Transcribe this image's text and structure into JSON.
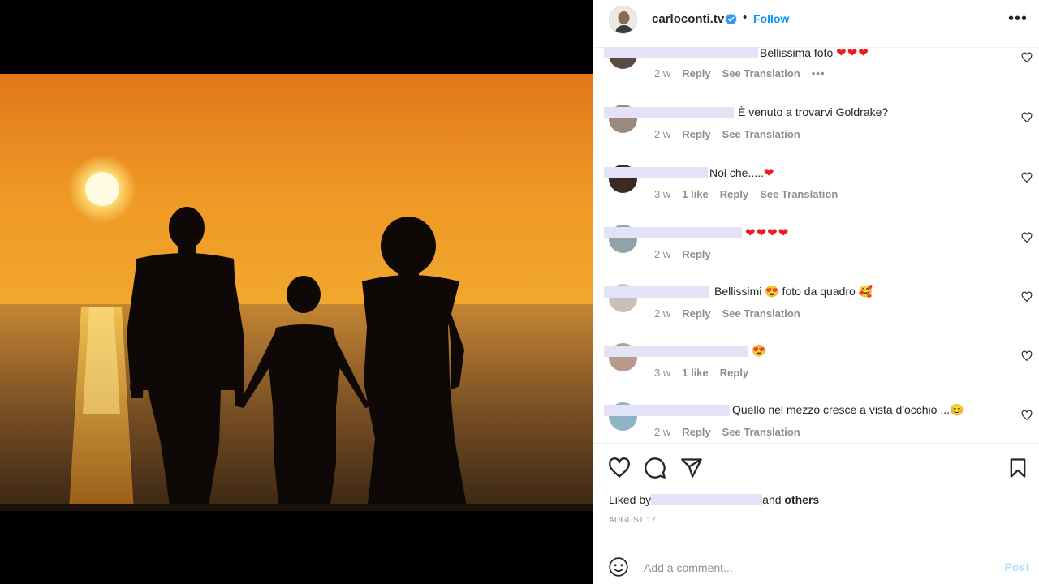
{
  "post": {
    "username": "carloconti.tv",
    "follow_label": "Follow",
    "more_label": "•••",
    "dot": "•"
  },
  "comments": [
    {
      "text": "Bellissima foto",
      "hearts": "❤❤❤",
      "time": "2 w",
      "reply": "Reply",
      "translate": "See Translation",
      "more": "•••"
    },
    {
      "text": "È venuto a trovarvi Goldrake?",
      "time": "2 w",
      "reply": "Reply",
      "translate": "See Translation"
    },
    {
      "text": "Noi che.....",
      "hearts": "❤",
      "time": "3 w",
      "likes": "1 like",
      "reply": "Reply",
      "translate": "See Translation"
    },
    {
      "text": "",
      "hearts": "❤❤❤❤",
      "time": "2 w",
      "reply": "Reply"
    },
    {
      "text": "Bellissimi 😍 foto da quadro 🥰",
      "time": "2 w",
      "reply": "Reply",
      "translate": "See Translation"
    },
    {
      "text": "😍",
      "time": "3 w",
      "likes": "1 like",
      "reply": "Reply"
    },
    {
      "text": "Quello nel mezzo cresce a vista d'occhio ...😊",
      "time": "2 w",
      "reply": "Reply",
      "translate": "See Translation"
    }
  ],
  "likes": {
    "prefix": "Liked by",
    "suffix_and": "and",
    "others": "others"
  },
  "date": "AUGUST 17",
  "add_comment": {
    "placeholder": "Add a comment...",
    "post_label": "Post"
  },
  "icons": [
    "heart-icon",
    "comment-icon",
    "share-icon",
    "bookmark-icon",
    "emoji-icon",
    "verified-icon"
  ],
  "colors": {
    "follow": "#0095f6",
    "post_disabled": "#b2dffc",
    "heart_red": "#ed1c24",
    "meta_gray": "#8e8e8e"
  }
}
